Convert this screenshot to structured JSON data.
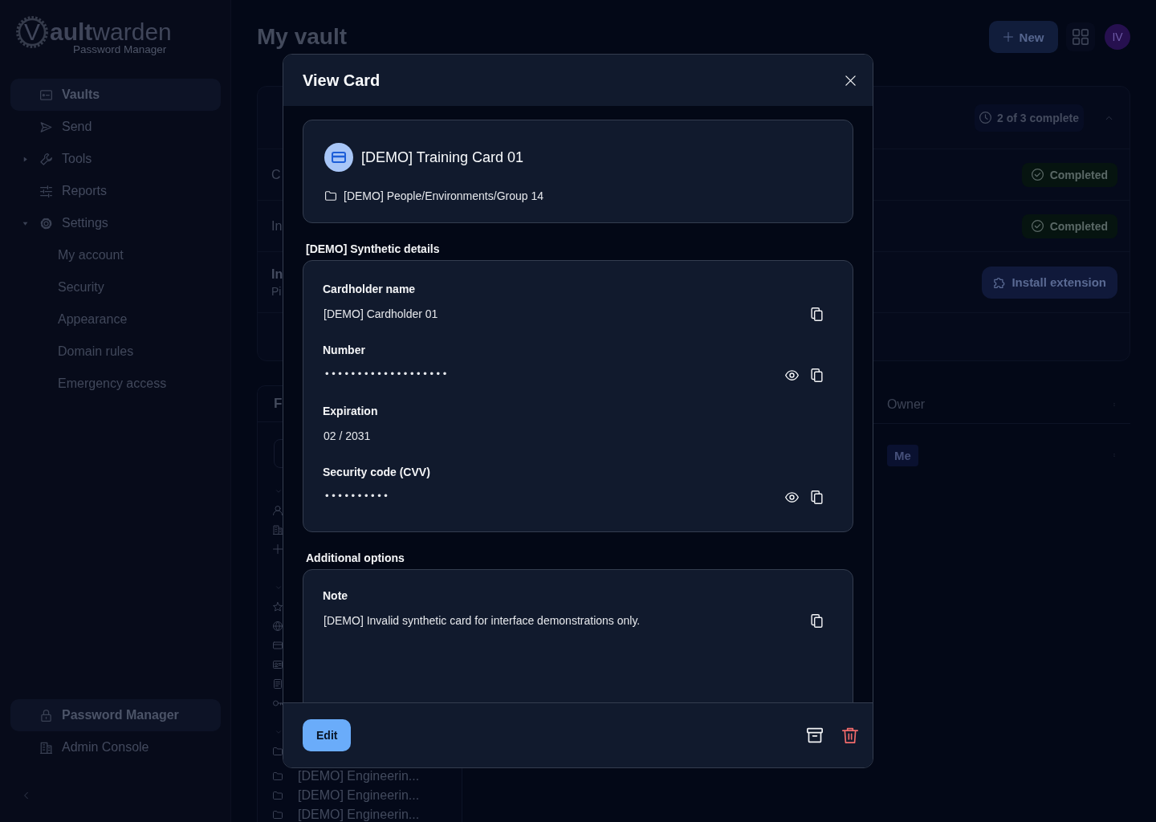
{
  "sidebar": {
    "logo": {
      "wordmark": "V**ault**warden",
      "subtitle": "Password Manager"
    },
    "nav": [
      {
        "label": "Vaults",
        "kind": "link",
        "selected": true
      },
      {
        "label": "Send",
        "kind": "link",
        "selected": false
      },
      {
        "label": "Tools",
        "kind": "group",
        "expanded": false,
        "selected": false
      },
      {
        "label": "Reports",
        "kind": "link",
        "selected": false
      },
      {
        "label": "Settings",
        "kind": "group",
        "expanded": true,
        "selected": false,
        "children": [
          {
            "label": "My account",
            "selected": false
          },
          {
            "label": "Security",
            "selected": false
          },
          {
            "label": "Appearance",
            "selected": false
          },
          {
            "label": "Domain rules",
            "selected": false
          },
          {
            "label": "Emergency access",
            "selected": false
          }
        ]
      }
    ],
    "products": [
      {
        "label": "Password Manager",
        "selected": true
      },
      {
        "label": "Admin Console",
        "selected": false
      }
    ]
  },
  "main": {
    "title": "My vault",
    "new_button": "New",
    "avatar": "IV",
    "onboarding": {
      "progress": "2 of 3 complete",
      "expanded": true,
      "tasks": [
        {
          "title": "C",
          "kind": "done",
          "status": "Completed"
        },
        {
          "title": "In",
          "kind": "done",
          "status": "Completed"
        },
        {
          "title": "In",
          "subtitle": "Pi",
          "kind": "action",
          "action": "Install extension"
        }
      ]
    },
    "filters": {
      "title": "F",
      "sections": [
        {
          "expanded": true
        },
        {
          "expanded": true
        },
        {
          "expanded": true,
          "folders": [
            "[DEMO] Engineerin...",
            "[DEMO] Engineerin...",
            "[DEMO] Engineerin..."
          ]
        }
      ]
    },
    "table": {
      "columns": [
        "Owner"
      ],
      "rows": [
        {
          "owner": "Me"
        }
      ]
    }
  },
  "dialog": {
    "title": "View Card",
    "item": {
      "name": "[DEMO] Training Card 01",
      "folder": "[DEMO] People/Environments/Group 14"
    },
    "sections": [
      {
        "heading": "[DEMO] Synthetic details",
        "fields": [
          {
            "label": "Cardholder name",
            "value": "[DEMO] Cardholder 01",
            "kind": "text"
          },
          {
            "label": "Number",
            "value": "•••••••••••••••••••",
            "kind": "secret"
          },
          {
            "label": "Expiration",
            "value": "02 / 2031",
            "kind": "plain"
          },
          {
            "label": "Security code (CVV)",
            "value": "••••••••••",
            "kind": "secret"
          }
        ]
      },
      {
        "heading": "Additional options",
        "fields": [
          {
            "label": "Note",
            "value": "[DEMO] Invalid synthetic card for interface demonstrations only.",
            "kind": "note"
          }
        ]
      }
    ],
    "footer": {
      "edit": "Edit"
    }
  }
}
